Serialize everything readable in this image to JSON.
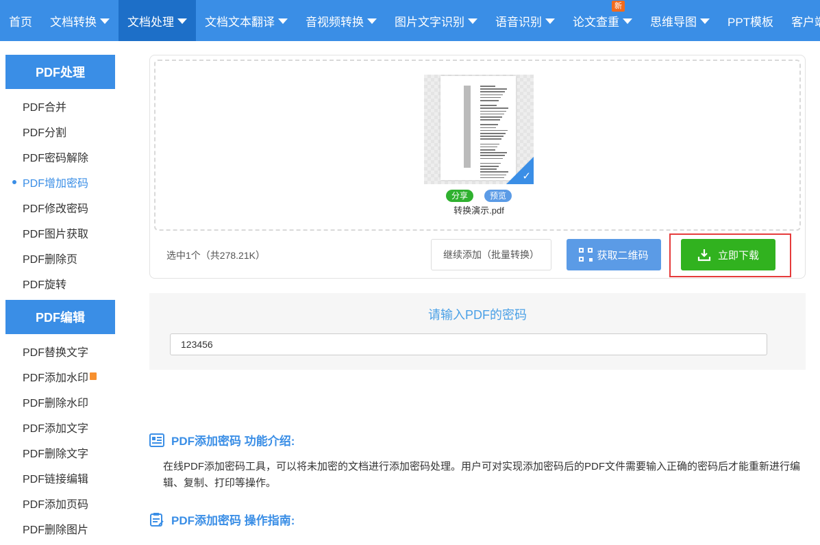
{
  "nav": {
    "items": [
      {
        "label": "首页",
        "caret": false
      },
      {
        "label": "文档转换",
        "caret": true
      },
      {
        "label": "文档处理",
        "caret": true,
        "active": true
      },
      {
        "label": "文档文本翻译",
        "caret": true
      },
      {
        "label": "音视频转换",
        "caret": true
      },
      {
        "label": "图片文字识别",
        "caret": true
      },
      {
        "label": "语音识别",
        "caret": true
      },
      {
        "label": "论文查重",
        "caret": true,
        "badge": "新"
      },
      {
        "label": "思维导图",
        "caret": true
      },
      {
        "label": "PPT模板",
        "caret": false
      },
      {
        "label": "客户端",
        "caret": true
      }
    ]
  },
  "sidebar": {
    "groups": [
      {
        "title": "PDF处理",
        "items": [
          "PDF合并",
          "PDF分割",
          "PDF密码解除",
          "PDF增加密码",
          "PDF修改密码",
          "PDF图片获取",
          "PDF删除页",
          "PDF旋转"
        ]
      },
      {
        "title": "PDF编辑",
        "items": [
          "PDF替换文字",
          "PDF添加水印",
          "PDF删除水印",
          "PDF添加文字",
          "PDF删除文字",
          "PDF链接编辑",
          "PDF添加页码",
          "PDF删除图片"
        ]
      }
    ],
    "active_item": "PDF增加密码"
  },
  "upload": {
    "share_label": "分享",
    "preview_label": "预览",
    "filename": "转换演示.pdf",
    "summary": "选中1个（共278.21K）",
    "continue_label": "继续添加（批量转换）",
    "qr_label": "获取二维码",
    "download_label": "立即下载"
  },
  "password": {
    "title": "请输入PDF的密码",
    "value": "123456"
  },
  "intro": {
    "head": "PDF添加密码 功能介绍:",
    "text": "在线PDF添加密码工具，可以将未加密的文档进行添加密码处理。用户可对实现添加密码后的PDF文件需要输入正确的密码后才能重新进行编辑、复制、打印等操作。"
  },
  "guide": {
    "head": "PDF添加密码 操作指南:"
  },
  "colors": {
    "primary": "#3a8ee6",
    "green": "#31b21f",
    "highlight": "#e53b3b"
  }
}
